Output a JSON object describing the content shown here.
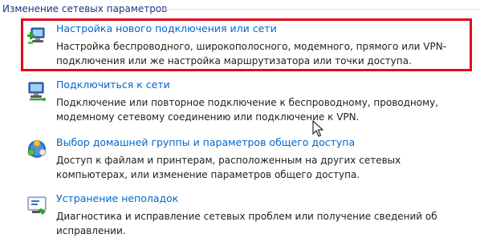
{
  "group": {
    "title": "Изменение сетевых параметров"
  },
  "tasks": [
    {
      "link": "Настройка нового подключения или сети",
      "desc": "Настройка беспроводного, широкополосного, модемного, прямого или VPN-подключения или же настройка маршрутизатора или точки доступа.",
      "icon": "new-connection-icon"
    },
    {
      "link": "Подключиться к сети",
      "desc": "Подключение или повторное подключение к беспроводному, проводному, модемному сетевому соединению или подключение к VPN.",
      "icon": "connect-to-network-icon"
    },
    {
      "link": "Выбор домашней группы и параметров общего доступа",
      "desc": "Доступ к файлам и принтерам, расположенным на других сетевых компьютерах, или изменение параметров общего доступа.",
      "icon": "homegroup-icon"
    },
    {
      "link": "Устранение неполадок",
      "desc": "Диагностика и исправление сетевых проблем или получение сведений об исправлении.",
      "icon": "troubleshoot-icon"
    }
  ],
  "colors": {
    "link": "#0066cc",
    "header": "#1e3287",
    "highlight": "#e2081c"
  }
}
